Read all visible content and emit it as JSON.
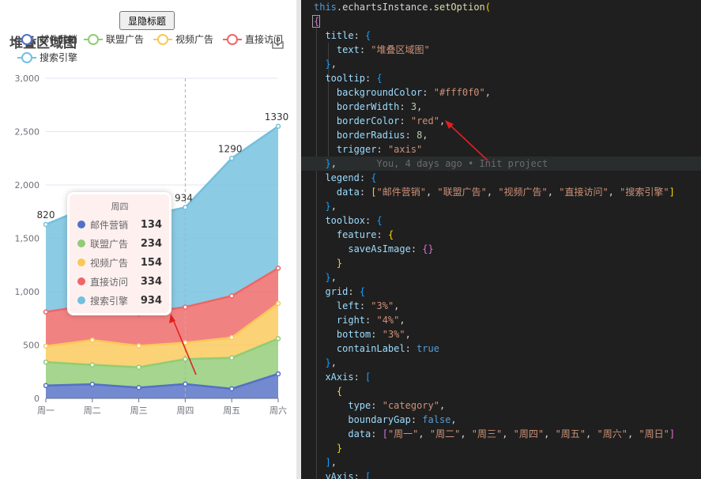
{
  "toggle_button": {
    "label": "显隐标题"
  },
  "chart": {
    "title": "堆叠区域图",
    "legend_entries": [
      {
        "name": "邮件营销",
        "color": "#5470c6"
      },
      {
        "name": "联盟广告",
        "color": "#91cc75"
      },
      {
        "name": "视频广告",
        "color": "#fac858"
      },
      {
        "name": "直接访问",
        "color": "#ee6666"
      },
      {
        "name": "搜索引擎",
        "color": "#73c0de"
      }
    ]
  },
  "chart_data": {
    "type": "area",
    "title": "堆叠区域图",
    "stacked": true,
    "categories": [
      "周一",
      "周二",
      "周三",
      "周四",
      "周五",
      "周六"
    ],
    "ylim": [
      0,
      3000
    ],
    "yticks": [
      "0",
      "500",
      "1,000",
      "1,500",
      "2,000",
      "2,500",
      "3,000"
    ],
    "grid": true,
    "legend_position": "top",
    "series": [
      {
        "name": "邮件营销",
        "color": "#5470c6",
        "values": [
          120,
          132,
          101,
          134,
          90,
          230
        ]
      },
      {
        "name": "联盟广告",
        "color": "#91cc75",
        "values": [
          220,
          182,
          191,
          234,
          290,
          330
        ]
      },
      {
        "name": "视频广告",
        "color": "#fac858",
        "values": [
          150,
          232,
          201,
          154,
          190,
          330
        ]
      },
      {
        "name": "直接访问",
        "color": "#ee6666",
        "values": [
          320,
          332,
          301,
          334,
          390,
          330
        ]
      },
      {
        "name": "搜索引擎",
        "color": "#73c0de",
        "values": [
          820,
          932,
          901,
          934,
          1290,
          1330
        ]
      }
    ],
    "top_labels": [
      "820",
      "",
      "",
      "934",
      "1290",
      "1330"
    ]
  },
  "tooltip": {
    "title": "周四",
    "rows": [
      {
        "name": "邮件营销",
        "value": "134",
        "color": "#5470c6"
      },
      {
        "name": "联盟广告",
        "value": "234",
        "color": "#91cc75"
      },
      {
        "name": "视频广告",
        "value": "154",
        "color": "#fac858"
      },
      {
        "name": "直接访问",
        "value": "334",
        "color": "#ee6666"
      },
      {
        "name": "搜索引擎",
        "value": "934",
        "color": "#73c0de"
      }
    ]
  },
  "code": {
    "lines": [
      [
        [
          "this",
          "this"
        ],
        [
          "plain",
          "."
        ],
        [
          "plain",
          "echartsInstance"
        ],
        [
          "plain",
          "."
        ],
        [
          "fn",
          "setOption"
        ],
        [
          "brk",
          "("
        ]
      ],
      [
        [
          "brk2",
          "{"
        ]
      ],
      [
        [
          "plain",
          "  "
        ],
        [
          "key",
          "title"
        ],
        [
          "plain",
          ": "
        ],
        [
          "brk3",
          "{"
        ]
      ],
      [
        [
          "plain",
          "    "
        ],
        [
          "key",
          "text"
        ],
        [
          "plain",
          ": "
        ],
        [
          "str",
          "\"堆叠区域图\""
        ]
      ],
      [
        [
          "plain",
          "  "
        ],
        [
          "brk3",
          "}"
        ],
        [
          "plain",
          ","
        ]
      ],
      [
        [
          "plain",
          "  "
        ],
        [
          "key",
          "tooltip"
        ],
        [
          "plain",
          ": "
        ],
        [
          "brk3",
          "{"
        ]
      ],
      [
        [
          "plain",
          "    "
        ],
        [
          "key",
          "backgroundColor"
        ],
        [
          "plain",
          ": "
        ],
        [
          "str",
          "\"#fff0f0\""
        ],
        [
          "plain",
          ","
        ]
      ],
      [
        [
          "plain",
          "    "
        ],
        [
          "key",
          "borderWidth"
        ],
        [
          "plain",
          ": "
        ],
        [
          "num",
          "3"
        ],
        [
          "plain",
          ","
        ]
      ],
      [
        [
          "plain",
          "    "
        ],
        [
          "key",
          "borderColor"
        ],
        [
          "plain",
          ": "
        ],
        [
          "str",
          "\"red\""
        ],
        [
          "plain",
          ","
        ]
      ],
      [
        [
          "plain",
          "    "
        ],
        [
          "key",
          "borderRadius"
        ],
        [
          "plain",
          ": "
        ],
        [
          "num",
          "8"
        ],
        [
          "plain",
          ","
        ]
      ],
      [
        [
          "plain",
          "    "
        ],
        [
          "key",
          "trigger"
        ],
        [
          "plain",
          ": "
        ],
        [
          "str",
          "\"axis\""
        ]
      ],
      [
        [
          "plain",
          "  "
        ],
        [
          "brk3",
          "}"
        ],
        [
          "plain",
          ","
        ],
        [
          "blame",
          "       You, 4 days ago • Init project"
        ]
      ],
      [
        [
          "plain",
          "  "
        ],
        [
          "key",
          "legend"
        ],
        [
          "plain",
          ": "
        ],
        [
          "brk3",
          "{"
        ]
      ],
      [
        [
          "plain",
          "    "
        ],
        [
          "key",
          "data"
        ],
        [
          "plain",
          ": "
        ],
        [
          "brk",
          "["
        ],
        [
          "str",
          "\"邮件营销\""
        ],
        [
          "plain",
          ", "
        ],
        [
          "str",
          "\"联盟广告\""
        ],
        [
          "plain",
          ", "
        ],
        [
          "str",
          "\"视频广告\""
        ],
        [
          "plain",
          ", "
        ],
        [
          "str",
          "\"直接访问\""
        ],
        [
          "plain",
          ", "
        ],
        [
          "str",
          "\"搜索引擎\""
        ],
        [
          "brk",
          "]"
        ]
      ],
      [
        [
          "plain",
          "  "
        ],
        [
          "brk3",
          "}"
        ],
        [
          "plain",
          ","
        ]
      ],
      [
        [
          "plain",
          "  "
        ],
        [
          "key",
          "toolbox"
        ],
        [
          "plain",
          ": "
        ],
        [
          "brk3",
          "{"
        ]
      ],
      [
        [
          "plain",
          "    "
        ],
        [
          "key",
          "feature"
        ],
        [
          "plain",
          ": "
        ],
        [
          "brk",
          "{"
        ]
      ],
      [
        [
          "plain",
          "      "
        ],
        [
          "key",
          "saveAsImage"
        ],
        [
          "plain",
          ": "
        ],
        [
          "brk2",
          "{}"
        ]
      ],
      [
        [
          "plain",
          "    "
        ],
        [
          "brk",
          "}"
        ]
      ],
      [
        [
          "plain",
          "  "
        ],
        [
          "brk3",
          "}"
        ],
        [
          "plain",
          ","
        ]
      ],
      [
        [
          "plain",
          "  "
        ],
        [
          "key",
          "grid"
        ],
        [
          "plain",
          ": "
        ],
        [
          "brk3",
          "{"
        ]
      ],
      [
        [
          "plain",
          "    "
        ],
        [
          "key",
          "left"
        ],
        [
          "plain",
          ": "
        ],
        [
          "str",
          "\"3%\""
        ],
        [
          "plain",
          ","
        ]
      ],
      [
        [
          "plain",
          "    "
        ],
        [
          "key",
          "right"
        ],
        [
          "plain",
          ": "
        ],
        [
          "str",
          "\"4%\""
        ],
        [
          "plain",
          ","
        ]
      ],
      [
        [
          "plain",
          "    "
        ],
        [
          "key",
          "bottom"
        ],
        [
          "plain",
          ": "
        ],
        [
          "str",
          "\"3%\""
        ],
        [
          "plain",
          ","
        ]
      ],
      [
        [
          "plain",
          "    "
        ],
        [
          "key",
          "containLabel"
        ],
        [
          "plain",
          ": "
        ],
        [
          "bool",
          "true"
        ]
      ],
      [
        [
          "plain",
          "  "
        ],
        [
          "brk3",
          "}"
        ],
        [
          "plain",
          ","
        ]
      ],
      [
        [
          "plain",
          "  "
        ],
        [
          "key",
          "xAxis"
        ],
        [
          "plain",
          ": "
        ],
        [
          "brk3",
          "["
        ]
      ],
      [
        [
          "plain",
          "    "
        ],
        [
          "brk",
          "{"
        ]
      ],
      [
        [
          "plain",
          "      "
        ],
        [
          "key",
          "type"
        ],
        [
          "plain",
          ": "
        ],
        [
          "str",
          "\"category\""
        ],
        [
          "plain",
          ","
        ]
      ],
      [
        [
          "plain",
          "      "
        ],
        [
          "key",
          "boundaryGap"
        ],
        [
          "plain",
          ": "
        ],
        [
          "bool",
          "false"
        ],
        [
          "plain",
          ","
        ]
      ],
      [
        [
          "plain",
          "      "
        ],
        [
          "key",
          "data"
        ],
        [
          "plain",
          ": "
        ],
        [
          "brk2",
          "["
        ],
        [
          "str",
          "\"周一\""
        ],
        [
          "plain",
          ", "
        ],
        [
          "str",
          "\"周二\""
        ],
        [
          "plain",
          ", "
        ],
        [
          "str",
          "\"周三\""
        ],
        [
          "plain",
          ", "
        ],
        [
          "str",
          "\"周四\""
        ],
        [
          "plain",
          ", "
        ],
        [
          "str",
          "\"周五\""
        ],
        [
          "plain",
          ", "
        ],
        [
          "str",
          "\"周六\""
        ],
        [
          "plain",
          ", "
        ],
        [
          "str",
          "\"周日\""
        ],
        [
          "brk2",
          "]"
        ]
      ],
      [
        [
          "plain",
          "    "
        ],
        [
          "brk",
          "}"
        ]
      ],
      [
        [
          "plain",
          "  "
        ],
        [
          "brk3",
          "]"
        ],
        [
          "plain",
          ","
        ]
      ],
      [
        [
          "plain",
          "  "
        ],
        [
          "key",
          "yAxis"
        ],
        [
          "plain",
          ": "
        ],
        [
          "brk3",
          "["
        ]
      ]
    ]
  }
}
